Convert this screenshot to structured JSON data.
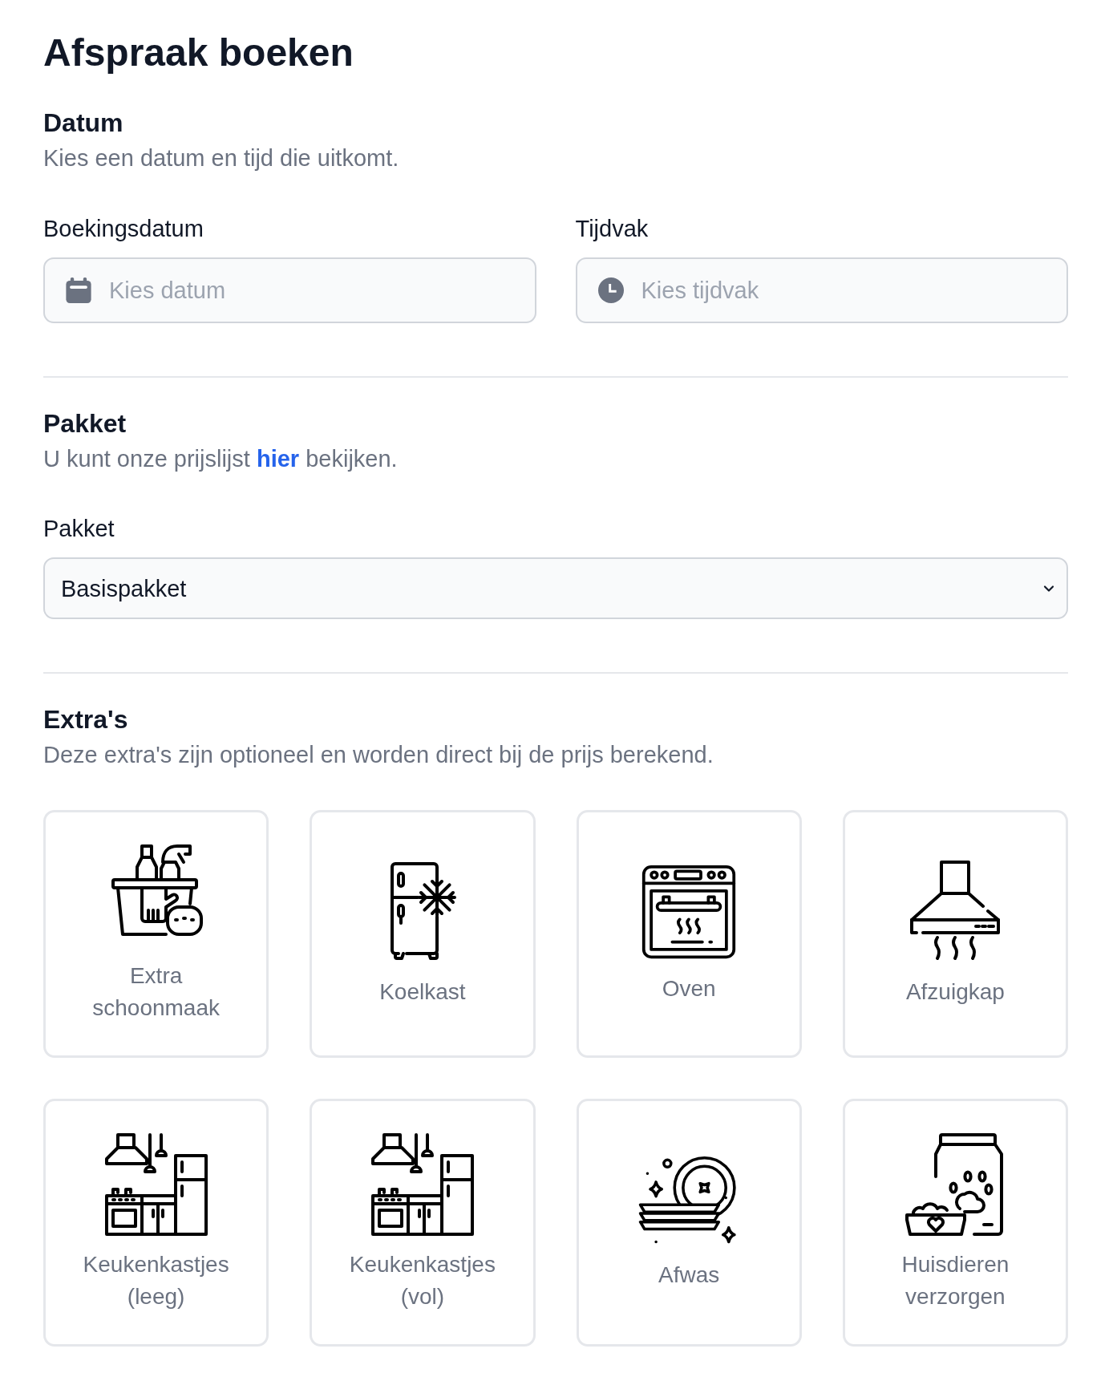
{
  "page": {
    "title": "Afspraak boeken"
  },
  "date_section": {
    "heading": "Datum",
    "description": "Kies een datum en tijd die uitkomt.",
    "fields": [
      {
        "kind": "date",
        "label": "Boekingsdatum",
        "placeholder": "Kies datum"
      },
      {
        "kind": "time",
        "label": "Tijdvak",
        "placeholder": "Kies tijdvak"
      }
    ]
  },
  "package_section": {
    "heading": "Pakket",
    "description": {
      "before": "U kunt onze prijslijst",
      "link": "hier",
      "after": "bekijken."
    },
    "select": {
      "label": "Pakket",
      "value": "Basispakket"
    }
  },
  "extras_section": {
    "heading": "Extra's",
    "description": "Deze extra's zijn optioneel en worden direct bij de prijs berekend.",
    "items": [
      {
        "label": "Extra schoonmaak"
      },
      {
        "label": "Koelkast"
      },
      {
        "label": "Oven"
      },
      {
        "label": "Afzuigkap"
      },
      {
        "label": "Keukenkastjes (leeg)"
      },
      {
        "label": "Keukenkastjes (vol)"
      },
      {
        "label": "Afwas"
      },
      {
        "label": "Huisdieren verzorgen"
      }
    ]
  }
}
